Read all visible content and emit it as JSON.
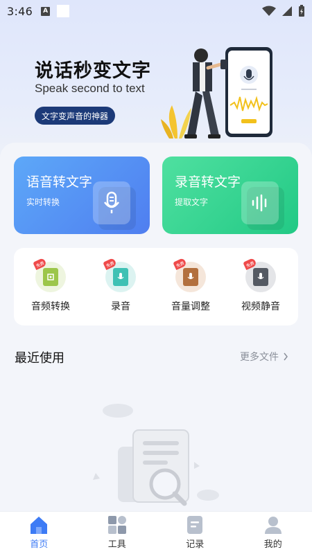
{
  "status_bar": {
    "time": "3:46",
    "notification_letter": "A"
  },
  "hero": {
    "title": "说话秒变文字",
    "subtitle": "Speak second to text",
    "tag": "文字变声音的神器"
  },
  "feature_cards": [
    {
      "title": "语音转文字",
      "subtitle": "实时转换",
      "icon": "microphone-icon"
    },
    {
      "title": "录音转文字",
      "subtitle": "提取文字",
      "icon": "waveform-icon"
    }
  ],
  "tools": {
    "badge": "免费",
    "items": [
      {
        "label": "音频转换",
        "icon": "audio-convert-icon",
        "color": "#9cc64a"
      },
      {
        "label": "录音",
        "icon": "record-icon",
        "color": "#3fc1b4"
      },
      {
        "label": "音量调整",
        "icon": "volume-icon",
        "color": "#b3703e"
      },
      {
        "label": "视频静音",
        "icon": "video-mute-icon",
        "color": "#555a63"
      }
    ]
  },
  "recent": {
    "title": "最近使用",
    "more_label": "更多文件"
  },
  "bottom_nav": [
    {
      "label": "首页",
      "icon": "home-icon",
      "active": true
    },
    {
      "label": "工具",
      "icon": "grid-icon",
      "active": false
    },
    {
      "label": "记录",
      "icon": "document-icon",
      "active": false
    },
    {
      "label": "我的",
      "icon": "user-icon",
      "active": false
    }
  ],
  "colors": {
    "accent": "#3d7bf5",
    "voice_card": "#4f7ef0",
    "record_card": "#22c985",
    "tag_bg": "#1c3a78"
  }
}
